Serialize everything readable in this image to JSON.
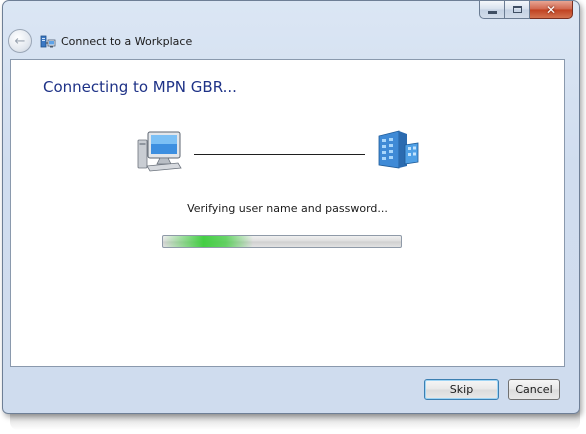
{
  "window": {
    "title": "Connect to a Workplace",
    "caption_buttons": {
      "minimize_icon": "minimize-icon",
      "maximize_icon": "maximize-icon",
      "close_glyph": "✕"
    }
  },
  "navigation": {
    "back_icon": "back-arrow-icon",
    "back_glyph": "←"
  },
  "main": {
    "heading": "Connecting to MPN GBR...",
    "status_text": "Verifying user name and password...",
    "left_icon": "computer-icon",
    "right_icon": "server-icon",
    "progress_fraction": 0.38
  },
  "footer": {
    "skip_label": "Skip",
    "cancel_label": "Cancel"
  },
  "colors": {
    "heading": "#1e3287",
    "progress_green": "#3ccd3c",
    "close_red": "#c0401f"
  }
}
